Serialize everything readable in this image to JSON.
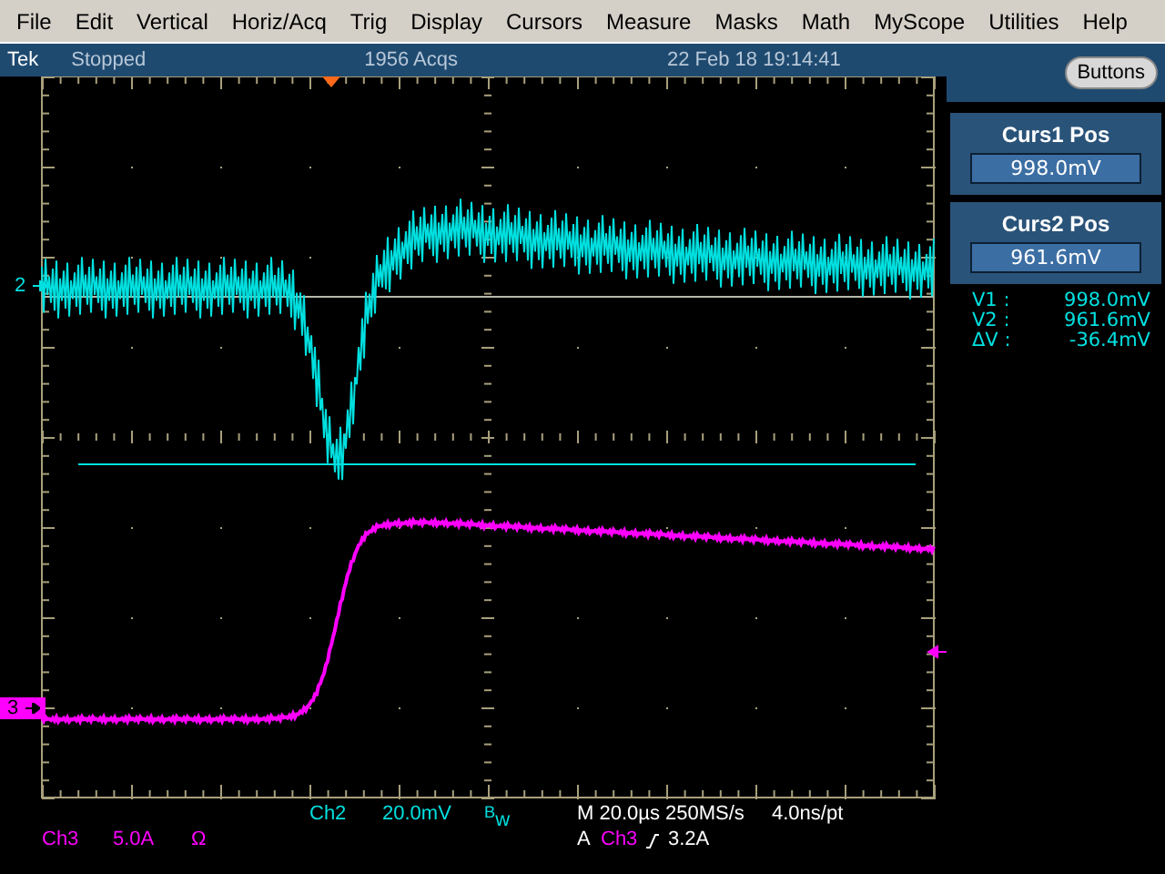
{
  "menu": [
    "File",
    "Edit",
    "Vertical",
    "Horiz/Acq",
    "Trig",
    "Display",
    "Cursors",
    "Measure",
    "Masks",
    "Math",
    "MyScope",
    "Utilities",
    "Help"
  ],
  "status_bar": {
    "brand": "Tek",
    "state": "Stopped",
    "acquisitions": "1956 Acqs",
    "datetime": "22 Feb 18 19:14:41"
  },
  "buttons_button": "Buttons",
  "cursor_panels": [
    {
      "title": "Curs1 Pos",
      "value": "998.0mV"
    },
    {
      "title": "Curs2 Pos",
      "value": "961.6mV"
    }
  ],
  "cursor_readouts": [
    {
      "label": "V1 :",
      "value": "998.0mV"
    },
    {
      "label": "V2 :",
      "value": "961.6mV"
    },
    {
      "label": "ΔV :",
      "value": "-36.4mV"
    }
  ],
  "channel_markers": [
    {
      "label": "2",
      "kind": "arrow",
      "color": "#00e0e0"
    },
    {
      "label": "3",
      "kind": "box",
      "color": "#ff00ff"
    }
  ],
  "channel_2_readout": {
    "channel": "Ch2",
    "scale": "20.0mV",
    "bandwidth": "$^{B}$w"
  },
  "channel_3_readout": {
    "channel": "Ch3",
    "scale": "5.0A",
    "coupling": "Ω"
  },
  "timebase": {
    "scale": "M 20.0µs 250MS/s",
    "resolution": "4.0ns/pt"
  },
  "trigger": {
    "mode": "A",
    "source": "Ch3",
    "level": "3.2A"
  }
}
